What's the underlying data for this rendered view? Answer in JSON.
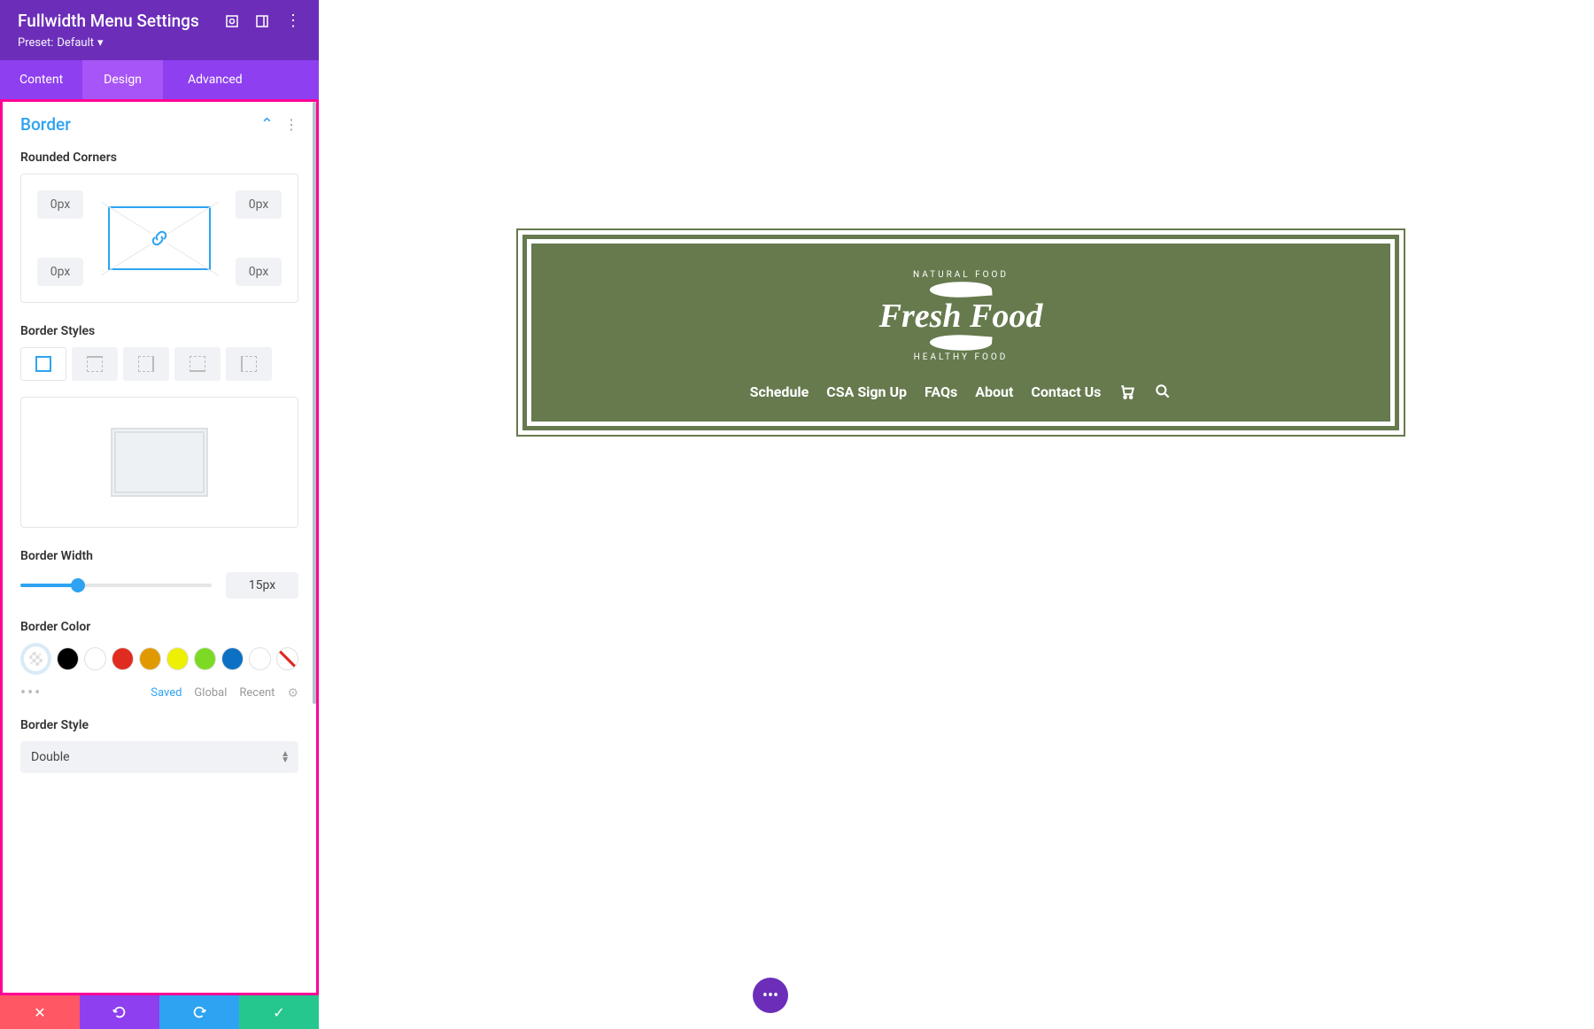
{
  "header": {
    "title": "Fullwidth Menu Settings",
    "preset_label": "Preset:",
    "preset_value": "Default"
  },
  "tabs": {
    "content": "Content",
    "design": "Design",
    "advanced": "Advanced",
    "active": "design"
  },
  "section": {
    "title": "Border"
  },
  "corners": {
    "label": "Rounded Corners",
    "tl": "0px",
    "tr": "0px",
    "bl": "0px",
    "br": "0px"
  },
  "styles": {
    "label": "Border Styles",
    "active": 0
  },
  "width": {
    "label": "Border Width",
    "value": "15px",
    "slider_pct": 30
  },
  "color": {
    "label": "Border Color",
    "swatches": [
      "#000000",
      "#ffffff",
      "#e02b20",
      "#e09900",
      "#edf000",
      "#7cda24",
      "#0c71c3",
      "#ffffff"
    ],
    "tabs": {
      "saved": "Saved",
      "global": "Global",
      "recent": "Recent",
      "active": "saved"
    }
  },
  "style_select": {
    "label": "Border Style",
    "value": "Double"
  },
  "menu_preview": {
    "brand_top": "NATURAL FOOD",
    "brand_main": "Fresh Food",
    "brand_bottom": "HEALTHY FOOD",
    "items": [
      "Schedule",
      "CSA Sign Up",
      "FAQs",
      "About",
      "Contact Us"
    ],
    "bg": "#667a4e",
    "border_width": "15px",
    "border_style": "double",
    "border_color": "#ffffff"
  }
}
